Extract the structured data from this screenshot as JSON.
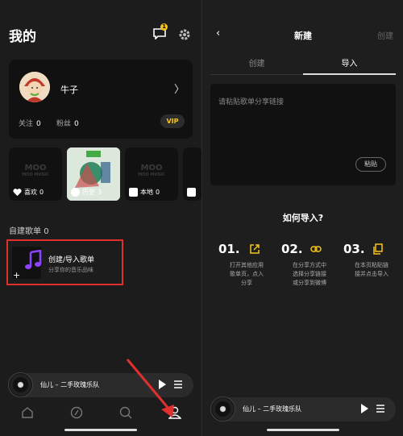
{
  "left": {
    "title": "我的",
    "badge": "1",
    "profile": {
      "name": "牛子",
      "chevron": "〉",
      "follow_label": "关注",
      "follow_count": "0",
      "fans_label": "粉丝",
      "fans_count": "0",
      "vip": "VIP"
    },
    "tiles": [
      {
        "label": "喜欢",
        "count": "0",
        "icon": "heart-icon"
      },
      {
        "label": "历史",
        "count": "3",
        "icon": "history-icon"
      },
      {
        "label": "本地",
        "count": "0",
        "icon": "download-icon"
      },
      {
        "label": "",
        "count": "",
        "icon": "bag-icon"
      }
    ],
    "tile_logo": "MOO",
    "tile_logo_sub": "MOO MUSIC",
    "section": {
      "label": "自建歌单",
      "count": "0"
    },
    "create": {
      "title": "创建/导入歌单",
      "subtitle": "分享你的音乐品味",
      "plus": "+"
    },
    "player": {
      "song": "仙儿 – 二手玫瑰乐队"
    },
    "nav": [
      "home-icon",
      "discover-icon",
      "search-icon",
      "profile-icon"
    ]
  },
  "right": {
    "back": "‹",
    "title": "新建",
    "action": "创建",
    "tabs": [
      "创建",
      "导入"
    ],
    "active_tab": 1,
    "paste_placeholder": "请粘贴歌单分享链接",
    "paste_button": "粘贴",
    "howto": "如何导入?",
    "steps": [
      {
        "num": "01.",
        "desc1": "打开其他应用",
        "desc2": "歌单页，点入",
        "desc3": "分享",
        "icon": "share-out-icon"
      },
      {
        "num": "02.",
        "desc1": "在分享方式中",
        "desc2": "选择分享链接",
        "desc3": "或分享到微博",
        "icon": "link-icon"
      },
      {
        "num": "03.",
        "desc1": "在本页粘贴链",
        "desc2": "接并点击导入",
        "desc3": "",
        "icon": "copy-icon"
      }
    ],
    "player": {
      "song": "仙儿 – 二手玫瑰乐队"
    }
  },
  "colors": {
    "accent": "#f5c518",
    "highlight": "#e0302e",
    "arrow": "#e0302e"
  }
}
